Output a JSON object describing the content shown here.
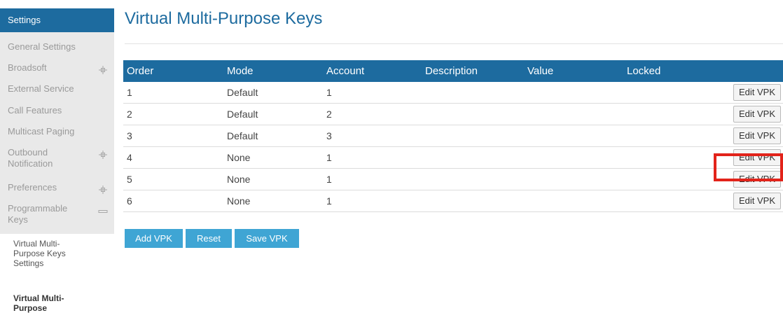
{
  "sidebar": {
    "header": "Settings",
    "items": [
      {
        "label": "General Settings",
        "expander": ""
      },
      {
        "label": "Broadsoft",
        "expander": "plus"
      },
      {
        "label": "External Service",
        "expander": ""
      },
      {
        "label": "Call Features",
        "expander": ""
      },
      {
        "label": "Multicast Paging",
        "expander": ""
      },
      {
        "label": "Outbound Notification",
        "expander": "plus"
      },
      {
        "label": "Preferences",
        "expander": "plus"
      },
      {
        "label": "Programmable Keys",
        "expander": "minus"
      }
    ],
    "subitems": [
      {
        "label": "Virtual Multi-Purpose Keys Settings",
        "active": false
      },
      {
        "label": "Virtual Multi-Purpose Keys",
        "active": true
      }
    ]
  },
  "main": {
    "title": "Virtual Multi-Purpose Keys",
    "table": {
      "columns": [
        "Order",
        "Mode",
        "Account",
        "Description",
        "Value",
        "Locked"
      ],
      "rows": [
        {
          "order": "1",
          "mode": "Default",
          "account": "1",
          "description": "",
          "value": "",
          "locked": "",
          "button": "Edit VPK"
        },
        {
          "order": "2",
          "mode": "Default",
          "account": "2",
          "description": "",
          "value": "",
          "locked": "",
          "button": "Edit VPK"
        },
        {
          "order": "3",
          "mode": "Default",
          "account": "3",
          "description": "",
          "value": "",
          "locked": "",
          "button": "Edit VPK"
        },
        {
          "order": "4",
          "mode": "None",
          "account": "1",
          "description": "",
          "value": "",
          "locked": "",
          "button": "Edit VPK"
        },
        {
          "order": "5",
          "mode": "None",
          "account": "1",
          "description": "",
          "value": "",
          "locked": "",
          "button": "Edit VPK"
        },
        {
          "order": "6",
          "mode": "None",
          "account": "1",
          "description": "",
          "value": "",
          "locked": "",
          "button": "Edit VPK"
        }
      ]
    },
    "actions": {
      "add": "Add VPK",
      "reset": "Reset",
      "save": "Save VPK"
    }
  },
  "colors": {
    "primary": "#1d6b9f",
    "action_button": "#3fa5d4",
    "sidebar_bg": "#e9e9e9",
    "sidebar_text": "#9a9a9a",
    "highlight": "#e2231a"
  },
  "icons": {
    "expand": "plus-icon",
    "collapse": "minus-icon"
  }
}
